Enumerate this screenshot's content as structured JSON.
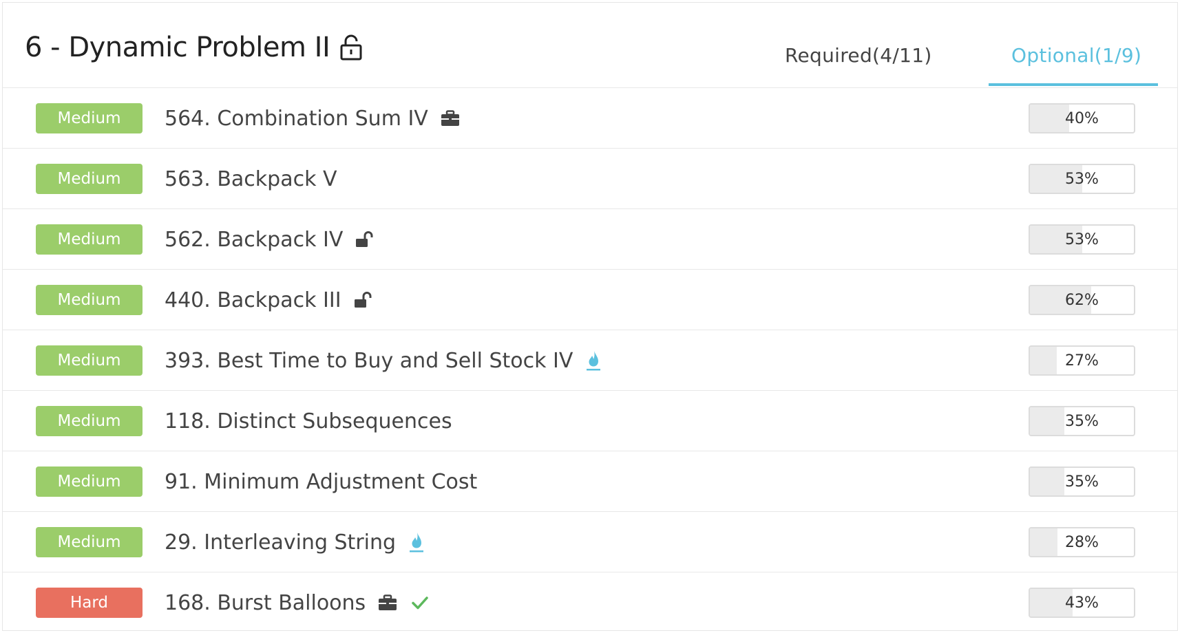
{
  "header": {
    "title": "6 - Dynamic Problem II",
    "tabs": [
      {
        "label": "Required(4/11)",
        "active": false
      },
      {
        "label": "Optional(1/9)",
        "active": true
      }
    ]
  },
  "colors": {
    "accent": "#5bc0de",
    "medium_badge": "#9bcd6a",
    "hard_badge": "#e8705f",
    "check": "#5cb85c"
  },
  "problems": [
    {
      "difficulty": "Medium",
      "title": "564. Combination Sum IV",
      "icons": [
        "briefcase-icon"
      ],
      "acceptance": "40%",
      "acceptance_value": 40
    },
    {
      "difficulty": "Medium",
      "title": "563. Backpack V",
      "icons": [],
      "acceptance": "53%",
      "acceptance_value": 53
    },
    {
      "difficulty": "Medium",
      "title": "562. Backpack IV",
      "icons": [
        "unlock-icon"
      ],
      "acceptance": "53%",
      "acceptance_value": 53
    },
    {
      "difficulty": "Medium",
      "title": "440. Backpack III",
      "icons": [
        "unlock-icon"
      ],
      "acceptance": "62%",
      "acceptance_value": 62
    },
    {
      "difficulty": "Medium",
      "title": "393. Best Time to Buy and Sell Stock IV",
      "icons": [
        "flame-icon"
      ],
      "acceptance": "27%",
      "acceptance_value": 27
    },
    {
      "difficulty": "Medium",
      "title": "118. Distinct Subsequences",
      "icons": [],
      "acceptance": "35%",
      "acceptance_value": 35
    },
    {
      "difficulty": "Medium",
      "title": "91. Minimum Adjustment Cost",
      "icons": [],
      "acceptance": "35%",
      "acceptance_value": 35
    },
    {
      "difficulty": "Medium",
      "title": "29. Interleaving String",
      "icons": [
        "flame-icon"
      ],
      "acceptance": "28%",
      "acceptance_value": 28
    },
    {
      "difficulty": "Hard",
      "title": "168. Burst Balloons",
      "icons": [
        "briefcase-icon",
        "check-icon"
      ],
      "acceptance": "43%",
      "acceptance_value": 43
    }
  ]
}
